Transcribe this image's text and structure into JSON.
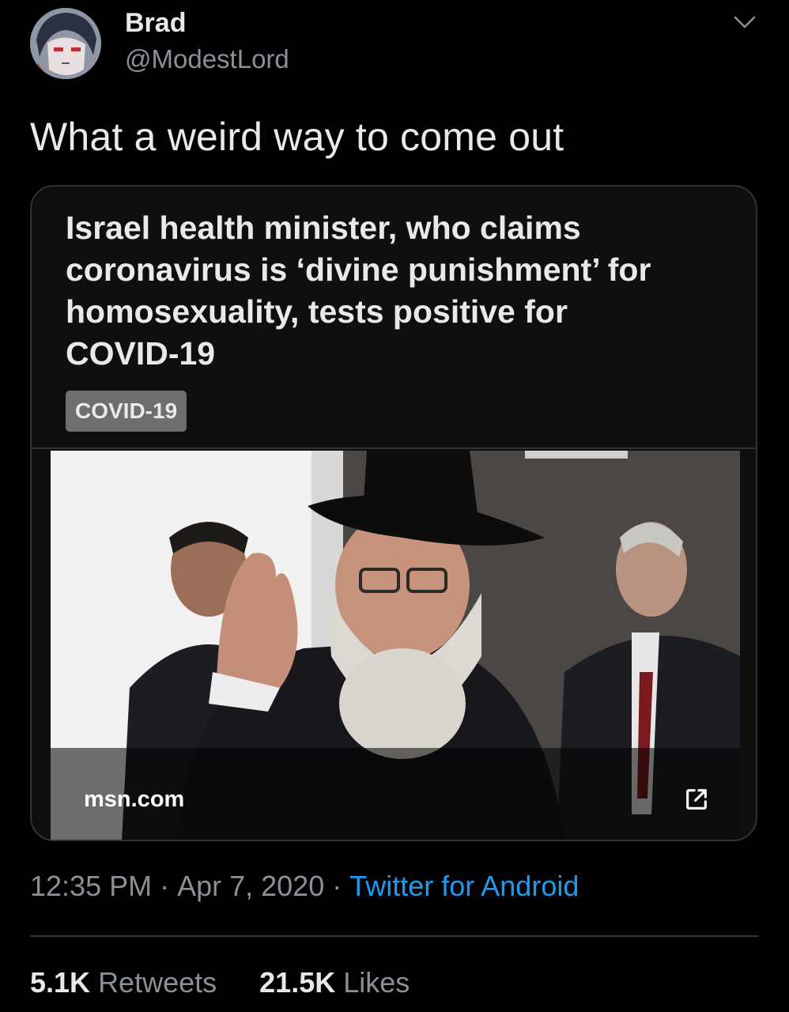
{
  "author": {
    "name": "Brad",
    "handle": "@ModestLord"
  },
  "tweet": {
    "text": "What a weird way to come out"
  },
  "card": {
    "title": "Israel health minister, who claims coronavirus is ‘divine punishment’ for homosexuality, tests positive for COVID-19",
    "tag": "COVID-19",
    "domain": "msn.com"
  },
  "meta": {
    "time": "12:35 PM",
    "date": "Apr 7, 2020",
    "separator": "·",
    "source": "Twitter for Android"
  },
  "stats": {
    "retweets_count": "5.1K",
    "retweets_label": "Retweets",
    "likes_count": "21.5K",
    "likes_label": "Likes"
  },
  "icons": {
    "caret": "chevron-down-icon",
    "external_link": "external-link-icon"
  },
  "colors": {
    "background": "#000000",
    "text": "#e7e9ea",
    "secondary_text": "#8b9097",
    "link": "#1d9bf0",
    "border": "#2f3336"
  }
}
